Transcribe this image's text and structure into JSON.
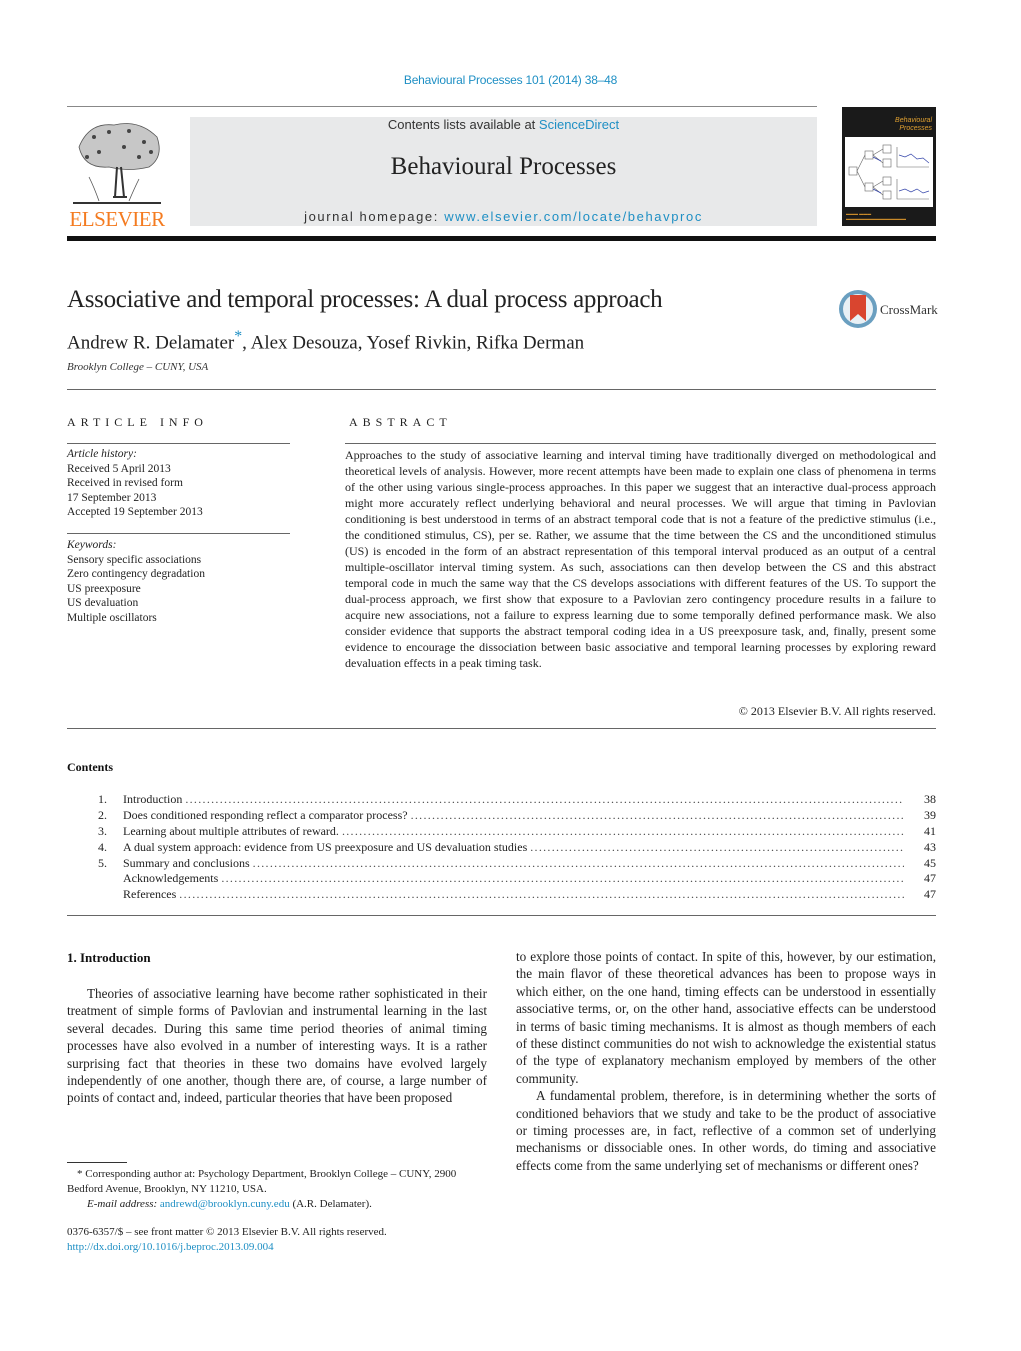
{
  "header": {
    "citation": "Behavioural Processes 101 (2014) 38–48",
    "contents_prefix": "Contents lists available at ",
    "contents_link": "ScienceDirect",
    "journal_name": "Behavioural Processes",
    "homepage_prefix": "journal homepage: ",
    "homepage_link": "www.elsevier.com/locate/behavproc",
    "publisher_logo": "ELSEVIER",
    "cover_title_line1": "Behavioural",
    "cover_title_line2": "Processes",
    "crossmark_label": "CrossMark"
  },
  "article": {
    "title": "Associative and temporal processes: A dual process approach",
    "authors_part1": "Andrew R. Delamater",
    "authors_star": "*",
    "authors_part2": ", Alex Desouza, Yosef Rivkin, Rifka Derman",
    "affiliation": "Brooklyn College – CUNY, USA"
  },
  "article_info": {
    "heading": "ARTICLE INFO",
    "history_label": "Article history:",
    "history": [
      "Received 5 April 2013",
      "Received in revised form",
      "17 September 2013",
      "Accepted 19 September 2013"
    ],
    "keywords_label": "Keywords:",
    "keywords": [
      "Sensory specific associations",
      "Zero contingency degradation",
      "US preexposure",
      "US devaluation",
      "Multiple oscillators"
    ]
  },
  "abstract": {
    "heading": "ABSTRACT",
    "text": "Approaches to the study of associative learning and interval timing have traditionally diverged on methodological and theoretical levels of analysis. However, more recent attempts have been made to explain one class of phenomena in terms of the other using various single-process approaches. In this paper we suggest that an interactive dual-process approach might more accurately reflect underlying behavioral and neural processes. We will argue that timing in Pavlovian conditioning is best understood in terms of an abstract temporal code that is not a feature of the predictive stimulus (i.e., the conditioned stimulus, CS), per se. Rather, we assume that the time between the CS and the unconditioned stimulus (US) is encoded in the form of an abstract representation of this temporal interval produced as an output of a central multiple-oscillator interval timing system. As such, associations can then develop between the CS and this abstract temporal code in much the same way that the CS develops associations with different features of the US. To support the dual-process approach, we first show that exposure to a Pavlovian zero contingency procedure results in a failure to acquire new associations, not a failure to express learning due to some temporally defined performance mask. We also consider evidence that supports the abstract temporal coding idea in a US preexposure task, and, finally, present some evidence to encourage the dissociation between basic associative and temporal learning processes by exploring reward devaluation effects in a peak timing task.",
    "copyright": "© 2013 Elsevier B.V. All rights reserved."
  },
  "contents": {
    "heading": "Contents",
    "dots": "................................................................................................................................................................................................................................................",
    "items": [
      {
        "num": "1.",
        "title": "Introduction",
        "page": "38"
      },
      {
        "num": "2.",
        "title": "Does conditioned responding reflect a comparator process?",
        "page": "39"
      },
      {
        "num": "3.",
        "title": "Learning about multiple attributes of reward.",
        "page": "41"
      },
      {
        "num": "4.",
        "title": "A dual system approach: evidence from US preexposure and US devaluation studies",
        "page": "43"
      },
      {
        "num": "5.",
        "title": "Summary and conclusions",
        "page": "45"
      },
      {
        "num": "",
        "title": "Acknowledgements",
        "page": "47"
      },
      {
        "num": "",
        "title": "References",
        "page": "47"
      }
    ]
  },
  "body": {
    "section_heading": "1.  Introduction",
    "left_para": "Theories of associative learning have become rather sophisticated in their treatment of simple forms of Pavlovian and instrumental learning in the last several decades. During this same time period theories of animal timing processes have also evolved in a number of interesting ways. It is a rather surprising fact that theories in these two domains have evolved largely independently of one another, though there are, of course, a large number of points of contact and, indeed, particular theories that have been proposed",
    "right_para1": "to explore those points of contact. In spite of this, however, by our estimation, the main flavor of these theoretical advances has been to propose ways in which either, on the one hand, timing effects can be understood in essentially associative terms, or, on the other hand, associative effects can be understood in terms of basic timing mechanisms. It is almost as though members of each of these distinct communities do not wish to acknowledge the existential status of the type of explanatory mechanism employed by members of the other community.",
    "right_para2": "A fundamental problem, therefore, is in determining whether the sorts of conditioned behaviors that we study and take to be the product of associative or timing processes are, in fact, reflective of a common set of underlying mechanisms or dissociable ones. In other words, do timing and associative effects come from the same underlying set of mechanisms or different ones?"
  },
  "footnote": {
    "corresponding": "* Corresponding author at: Psychology Department, Brooklyn College – CUNY, 2900 Bedford Avenue, Brooklyn, NY 11210, USA.",
    "email_label": "E-mail address: ",
    "email": "andrewd@brooklyn.cuny.edu",
    "email_suffix": " (A.R. Delamater).",
    "front_matter": "0376-6357/$ – see front matter © 2013 Elsevier B.V. All rights reserved.",
    "doi": "http://dx.doi.org/10.1016/j.beproc.2013.09.004"
  }
}
